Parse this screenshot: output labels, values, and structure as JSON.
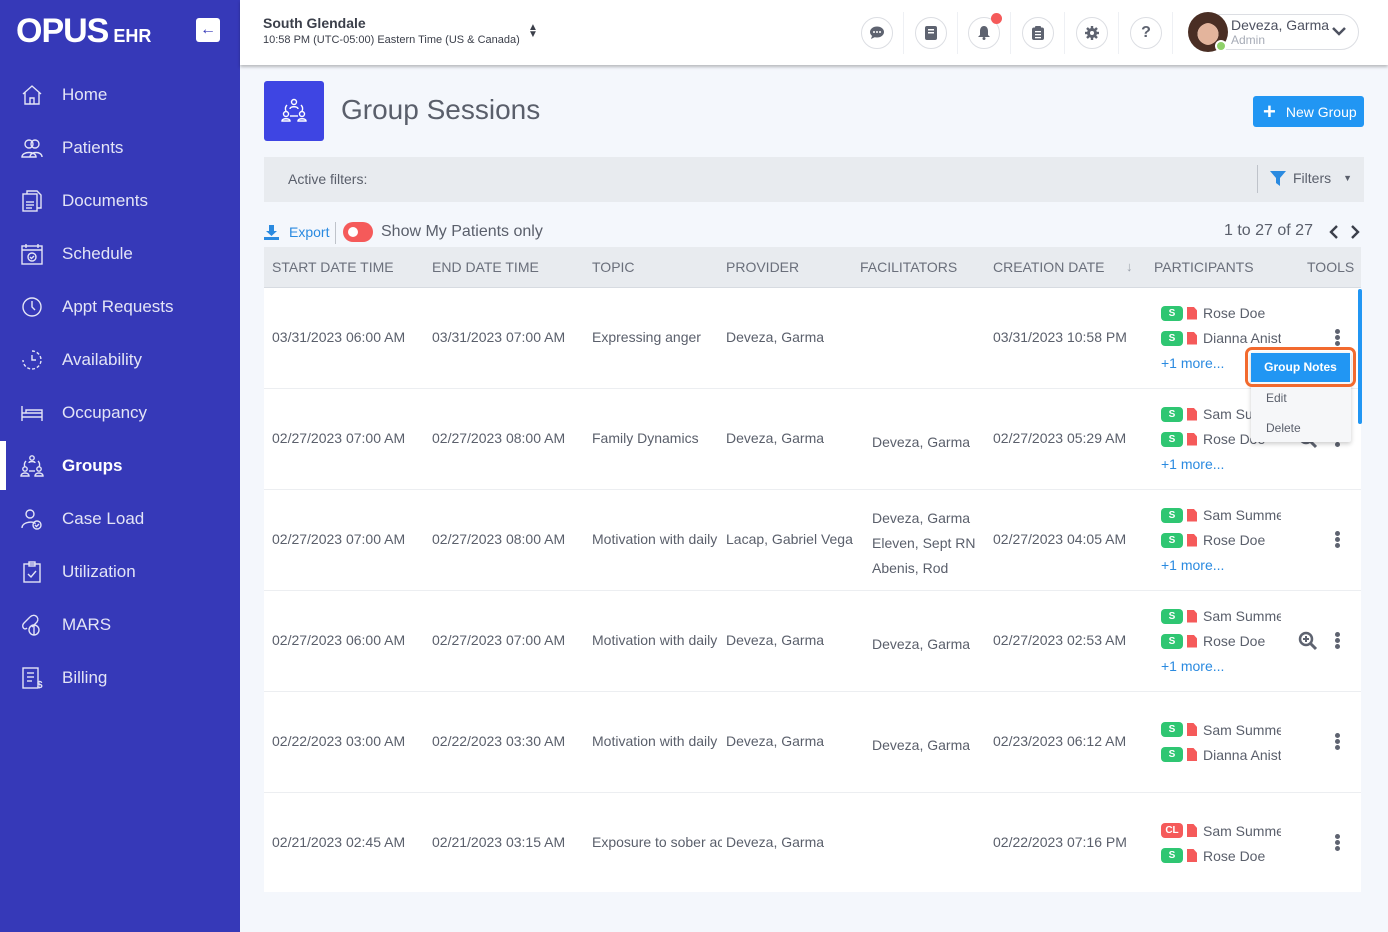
{
  "app": {
    "brand": "OPUS",
    "brand_suffix": "EHR",
    "collapse_icon": "arrow-left"
  },
  "sidebar": {
    "items": [
      {
        "label": "Home",
        "icon": "home-icon",
        "active": false
      },
      {
        "label": "Patients",
        "icon": "patients-icon",
        "active": false
      },
      {
        "label": "Documents",
        "icon": "documents-icon",
        "active": false
      },
      {
        "label": "Schedule",
        "icon": "schedule-icon",
        "active": false
      },
      {
        "label": "Appt Requests",
        "icon": "clock-icon",
        "active": false
      },
      {
        "label": "Availability",
        "icon": "availability-icon",
        "active": false
      },
      {
        "label": "Occupancy",
        "icon": "bed-icon",
        "active": false
      },
      {
        "label": "Groups",
        "icon": "groups-icon",
        "active": true
      },
      {
        "label": "Case Load",
        "icon": "case-load-icon",
        "active": false
      },
      {
        "label": "Utilization",
        "icon": "clipboard-check-icon",
        "active": false
      },
      {
        "label": "MARS",
        "icon": "pills-icon",
        "active": false
      },
      {
        "label": "Billing",
        "icon": "billing-icon",
        "active": false
      }
    ]
  },
  "topbar": {
    "location": "South Glendale",
    "timezone": "10:58 PM (UTC-05:00) Eastern Time (US & Canada)",
    "buttons": [
      "chat-icon",
      "book-icon",
      "bell-icon",
      "clipboard-icon",
      "gear-icon",
      "help-icon"
    ],
    "notification_dot_color": "#f55a5a",
    "user": {
      "name": "Deveza, Garma",
      "role": "Admin",
      "status": "online"
    }
  },
  "page": {
    "title": "Group Sessions",
    "new_button": "New Group",
    "active_filters_label": "Active filters:",
    "filters_button": "Filters",
    "export_label": "Export",
    "toggle_label": "Show My Patients only",
    "toggle_on": false,
    "pagination": "1 to 27 of 27",
    "accent_color": "#2196f3",
    "brand_color": "#3639b8"
  },
  "table": {
    "columns": [
      "START DATE TIME",
      "END DATE TIME",
      "TOPIC",
      "PROVIDER",
      "FACILITATORS",
      "CREATION DATE",
      "PARTICIPANTS",
      "TOOLS"
    ],
    "sort_column": "CREATION DATE",
    "sort_direction": "desc",
    "rows": [
      {
        "start": "03/31/2023 06:00 AM",
        "end": "03/31/2023 07:00 AM",
        "topic": "Expressing anger",
        "provider": "Deveza, Garma",
        "facilitators": [],
        "created": "03/31/2023 10:58 PM",
        "participants": [
          {
            "badge": "S",
            "name": "Rose Doe"
          },
          {
            "badge": "S",
            "name": "Dianna Aniston"
          }
        ],
        "more": "+1 more...",
        "has_zoom": false
      },
      {
        "start": "02/27/2023 07:00 AM",
        "end": "02/27/2023 08:00 AM",
        "topic": "Family Dynamics",
        "provider": "Deveza, Garma",
        "facilitators": [
          "Deveza, Garma"
        ],
        "created": "02/27/2023 05:29 AM",
        "participants": [
          {
            "badge": "S",
            "name": "Sam Summers"
          },
          {
            "badge": "S",
            "name": "Rose Doe"
          }
        ],
        "more": "+1 more...",
        "has_zoom": true
      },
      {
        "start": "02/27/2023 07:00 AM",
        "end": "02/27/2023 08:00 AM",
        "topic": "Motivation with daily",
        "provider": "Lacap, Gabriel Vega",
        "facilitators": [
          "Deveza, Garma",
          "Eleven, Sept RN",
          "Abenis, Rod"
        ],
        "created": "02/27/2023 04:05 AM",
        "participants": [
          {
            "badge": "S",
            "name": "Sam Summers"
          },
          {
            "badge": "S",
            "name": "Rose Doe"
          }
        ],
        "more": "+1 more...",
        "has_zoom": false
      },
      {
        "start": "02/27/2023 06:00 AM",
        "end": "02/27/2023 07:00 AM",
        "topic": "Motivation with daily",
        "provider": "Deveza, Garma",
        "facilitators": [
          "Deveza, Garma"
        ],
        "created": "02/27/2023 02:53 AM",
        "participants": [
          {
            "badge": "S",
            "name": "Sam Summers"
          },
          {
            "badge": "S",
            "name": "Rose Doe"
          }
        ],
        "more": "+1 more...",
        "has_zoom": true
      },
      {
        "start": "02/22/2023 03:00 AM",
        "end": "02/22/2023 03:30 AM",
        "topic": "Motivation with daily",
        "provider": "Deveza, Garma",
        "facilitators": [
          "Deveza, Garma"
        ],
        "created": "02/23/2023 06:12 AM",
        "participants": [
          {
            "badge": "S",
            "name": "Sam Summers"
          },
          {
            "badge": "S",
            "name": "Dianna Aniston"
          }
        ],
        "more": "",
        "has_zoom": false
      },
      {
        "start": "02/21/2023 02:45 AM",
        "end": "02/21/2023 03:15 AM",
        "topic": "Exposure to sober activities",
        "provider": "Deveza, Garma",
        "facilitators": [],
        "created": "02/22/2023 07:16 PM",
        "participants": [
          {
            "badge": "CL",
            "name": "Sam Summers"
          },
          {
            "badge": "S",
            "name": "Rose Doe"
          }
        ],
        "more": "",
        "has_zoom": false
      }
    ]
  },
  "context_menu": {
    "items": [
      "Group Notes",
      "Edit",
      "Delete"
    ],
    "highlighted": "Group Notes"
  }
}
